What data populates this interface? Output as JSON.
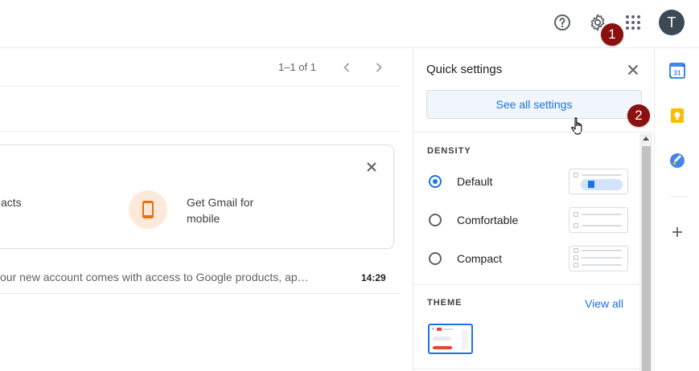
{
  "header": {
    "help_icon": "help-circle-icon",
    "settings_icon": "gear-icon",
    "apps_icon": "apps-grid-icon",
    "avatar_letter": "T"
  },
  "markers": [
    "1",
    "2"
  ],
  "mail": {
    "pager_text": "1–1 of 1",
    "card": {
      "left_fragment": "acts",
      "mobile_line1": "Get Gmail for",
      "mobile_line2": "mobile"
    },
    "row": {
      "snippet": "our new account comes with access to Google products, ap…",
      "time": "14:29"
    }
  },
  "quick_settings": {
    "title": "Quick settings",
    "see_all_label": "See all settings",
    "density": {
      "label": "DENSITY",
      "options": [
        {
          "label": "Default",
          "selected": true
        },
        {
          "label": "Comfortable",
          "selected": false
        },
        {
          "label": "Compact",
          "selected": false
        }
      ]
    },
    "theme": {
      "label": "THEME",
      "view_all": "View all"
    }
  },
  "colors": {
    "accent": "#1a73e8",
    "marker": "#8b1111",
    "avatar": "#3c4a55"
  }
}
